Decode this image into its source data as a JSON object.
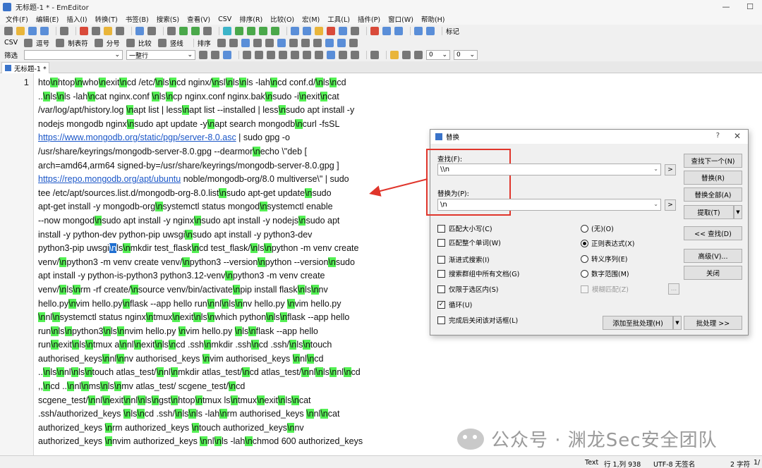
{
  "window": {
    "title": "无标题-1 * - EmEditor"
  },
  "menu": [
    "文件(F)",
    "编辑(E)",
    "插入(I)",
    "转换(T)",
    "书签(B)",
    "搜索(S)",
    "查看(V)",
    "CSV",
    "排序(R)",
    "比较(O)",
    "宏(M)",
    "工具(L)",
    "插件(P)",
    "窗口(W)",
    "帮助(H)"
  ],
  "toolbar1": {
    "label": "标记"
  },
  "toolbar2": {
    "csv": "CSV",
    "items": [
      "逗号",
      "制表符",
      "分号",
      "比较",
      "竖线"
    ],
    "sort": "排序"
  },
  "toolbar3": {
    "filter_label": "筛选",
    "match_label": "一整行",
    "num1": "0",
    "num2": "0"
  },
  "tab": {
    "label": "无标题-1 *"
  },
  "editor": {
    "line_number": "1",
    "lines": [
      [
        [
          "hto",
          0
        ],
        [
          "\\n",
          1
        ],
        [
          "htop",
          0
        ],
        [
          "\\n",
          1
        ],
        [
          "who",
          0
        ],
        [
          "\\n",
          1
        ],
        [
          "exit",
          0
        ],
        [
          "\\n",
          1
        ],
        [
          "cd /etc/",
          0
        ],
        [
          "\\n",
          1
        ],
        [
          "ls",
          0
        ],
        [
          "\\n",
          1
        ],
        [
          "cd nginx/",
          0
        ],
        [
          "\\n",
          1
        ],
        [
          "sl",
          0
        ],
        [
          "\\n",
          1
        ],
        [
          "ls",
          0
        ],
        [
          "\\n",
          1
        ],
        [
          "ls -lah",
          0
        ],
        [
          "\\n",
          1
        ],
        [
          "cd conf.d/",
          0
        ],
        [
          "\\n",
          1
        ],
        [
          "ls",
          0
        ],
        [
          "\\n",
          1
        ],
        [
          "cd",
          0
        ]
      ],
      [
        [
          "..",
          0
        ],
        [
          "\\n",
          1
        ],
        [
          "ls",
          0
        ],
        [
          "\\n",
          1
        ],
        [
          "ls -lah",
          0
        ],
        [
          "\\n",
          1
        ],
        [
          "cat nginx.conf ",
          0
        ],
        [
          "\\n",
          1
        ],
        [
          "ls",
          0
        ],
        [
          "\\n",
          1
        ],
        [
          "cp nginx.conf nginx.bak",
          0
        ],
        [
          "\\n",
          1
        ],
        [
          "sudo -i",
          0
        ],
        [
          "\\n",
          1
        ],
        [
          "exit",
          0
        ],
        [
          "\\n",
          1
        ],
        [
          "cat",
          0
        ]
      ],
      [
        [
          "/var/log/apt/history.log ",
          0
        ],
        [
          "\\n",
          1
        ],
        [
          "apt list | less",
          0
        ],
        [
          "\\n",
          1
        ],
        [
          "apt list --installed | less",
          0
        ],
        [
          "\\n",
          1
        ],
        [
          "sudo apt install -y",
          0
        ]
      ],
      [
        [
          "nodejs mongodb nginx",
          0
        ],
        [
          "\\n",
          1
        ],
        [
          "sudo apt update -y",
          0
        ],
        [
          "\\n",
          1
        ],
        [
          "apt search mongodb",
          0
        ],
        [
          "\\n",
          1
        ],
        [
          "curl -fsSL",
          0
        ]
      ],
      [
        [
          "https://www.mongodb.org/static/pgp/server-8.0.asc",
          2
        ],
        [
          " |    sudo gpg -o",
          0
        ]
      ],
      [
        [
          "/usr/share/keyrings/mongodb-server-8.0.gpg    --dearmor",
          0
        ],
        [
          "\\n",
          1
        ],
        [
          "echo \\\"deb [",
          0
        ]
      ],
      [
        [
          "arch=amd64,arm64 signed-by=/usr/share/keyrings/mongodb-server-8.0.gpg ]",
          0
        ]
      ],
      [
        [
          "https://repo.mongodb.org/apt/ubuntu",
          2
        ],
        [
          " noble/mongodb-org/8.0 multiverse\\\" | sudo",
          0
        ]
      ],
      [
        [
          "tee /etc/apt/sources.list.d/mongodb-org-8.0.list",
          0
        ],
        [
          "\\n",
          1
        ],
        [
          "sudo apt-get update",
          0
        ],
        [
          "\\n",
          1
        ],
        [
          "sudo",
          0
        ]
      ],
      [
        [
          "apt-get install -y mongodb-org",
          0
        ],
        [
          "\\n",
          1
        ],
        [
          "systemctl status mongod",
          0
        ],
        [
          "\\n",
          1
        ],
        [
          "systemctl enable",
          0
        ]
      ],
      [
        [
          "--now mongod",
          0
        ],
        [
          "\\n",
          1
        ],
        [
          "sudo apt install -y nginx",
          0
        ],
        [
          "\\n",
          1
        ],
        [
          "sudo apt install -y nodejs",
          0
        ],
        [
          "\\n",
          1
        ],
        [
          "sudo apt",
          0
        ]
      ],
      [
        [
          "install -y python-dev python-pip uwsgi",
          0
        ],
        [
          "\\n",
          1
        ],
        [
          "sudo apt install -y python3-dev",
          0
        ]
      ],
      [
        [
          "python3-pip uwsgi",
          0
        ],
        [
          "\\n",
          3
        ],
        [
          "ls",
          0
        ],
        [
          "\\n",
          1
        ],
        [
          "mkdir test_flask",
          0
        ],
        [
          "\\n",
          1
        ],
        [
          "cd test_flask/",
          0
        ],
        [
          "\\n",
          1
        ],
        [
          "ls",
          0
        ],
        [
          "\\n",
          1
        ],
        [
          "python -m venv create",
          0
        ]
      ],
      [
        [
          "venv/",
          0
        ],
        [
          "\\n",
          1
        ],
        [
          "python3 -m venv create venv/",
          0
        ],
        [
          "\\n",
          1
        ],
        [
          "python3 --version",
          0
        ],
        [
          "\\n",
          1
        ],
        [
          "python --version",
          0
        ],
        [
          "\\n",
          1
        ],
        [
          "sudo",
          0
        ]
      ],
      [
        [
          "apt install -y python-is-python3 python3.12-venv",
          0
        ],
        [
          "\\n",
          1
        ],
        [
          "python3 -m venv create",
          0
        ]
      ],
      [
        [
          "venv/",
          0
        ],
        [
          "\\n",
          1
        ],
        [
          "ls",
          0
        ],
        [
          "\\n",
          1
        ],
        [
          "rm -rf create/",
          0
        ],
        [
          "\\n",
          1
        ],
        [
          "source venv/bin/activate",
          0
        ],
        [
          "\\n",
          1
        ],
        [
          "pip install flask",
          0
        ],
        [
          "\\n",
          1
        ],
        [
          "ls",
          0
        ],
        [
          "\\n",
          1
        ],
        [
          "nv",
          0
        ]
      ],
      [
        [
          "hello.py",
          0
        ],
        [
          "\\n",
          1
        ],
        [
          "vim hello.py",
          0
        ],
        [
          "\\n",
          1
        ],
        [
          "flask --app hello run",
          0
        ],
        [
          "\\n",
          1
        ],
        [
          "nl",
          0
        ],
        [
          "\\n",
          1
        ],
        [
          "ls",
          0
        ],
        [
          "\\n",
          1
        ],
        [
          "nv hello.py ",
          0
        ],
        [
          "\\n",
          1
        ],
        [
          "vim hello.py",
          0
        ]
      ],
      [
        [
          "\\n",
          1
        ],
        [
          "nl",
          0
        ],
        [
          "\\n",
          1
        ],
        [
          "systemctl status nginx",
          0
        ],
        [
          "\\n",
          1
        ],
        [
          "tmux",
          0
        ],
        [
          "\\n",
          1
        ],
        [
          "exit",
          0
        ],
        [
          "\\n",
          1
        ],
        [
          "ls",
          0
        ],
        [
          "\\n",
          1
        ],
        [
          "which python",
          0
        ],
        [
          "\\n",
          1
        ],
        [
          "ls",
          0
        ],
        [
          "\\n",
          1
        ],
        [
          "flask --app hello",
          0
        ]
      ],
      [
        [
          "run",
          0
        ],
        [
          "\\n",
          1
        ],
        [
          "ls",
          0
        ],
        [
          "\\n",
          1
        ],
        [
          "python3",
          0
        ],
        [
          "\\n",
          1
        ],
        [
          "ls",
          0
        ],
        [
          "\\n",
          1
        ],
        [
          "nvim hello.py ",
          0
        ],
        [
          "\\n",
          1
        ],
        [
          "vim hello.py ",
          0
        ],
        [
          "\\n",
          1
        ],
        [
          "ls",
          0
        ],
        [
          "\\n",
          1
        ],
        [
          "flask --app hello",
          0
        ]
      ],
      [
        [
          "run",
          0
        ],
        [
          "\\n",
          1
        ],
        [
          "exit",
          0
        ],
        [
          "\\n",
          1
        ],
        [
          "ls",
          0
        ],
        [
          "\\n",
          1
        ],
        [
          "tmux a",
          0
        ],
        [
          "\\n",
          1
        ],
        [
          "nl",
          0
        ],
        [
          "\\n",
          1
        ],
        [
          "exit",
          0
        ],
        [
          "\\n",
          1
        ],
        [
          "ls",
          0
        ],
        [
          "\\n",
          1
        ],
        [
          "cd .ssh",
          0
        ],
        [
          "\\n",
          1
        ],
        [
          "mkdir .ssh",
          0
        ],
        [
          "\\n",
          1
        ],
        [
          "cd .ssh/",
          0
        ],
        [
          "\\n",
          1
        ],
        [
          "ls",
          0
        ],
        [
          "\\n",
          1
        ],
        [
          "touch",
          0
        ]
      ],
      [
        [
          "authorised_keys",
          0
        ],
        [
          "\\n",
          1
        ],
        [
          "nl",
          0
        ],
        [
          "\\n",
          1
        ],
        [
          "nv authorised_keys ",
          0
        ],
        [
          "\\n",
          1
        ],
        [
          "vim authorised_keys ",
          0
        ],
        [
          "\\n",
          1
        ],
        [
          "nl",
          0
        ],
        [
          "\\n",
          1
        ],
        [
          "cd",
          0
        ]
      ],
      [
        [
          "..",
          0
        ],
        [
          "\\n",
          1
        ],
        [
          "ls",
          0
        ],
        [
          "\\n",
          1
        ],
        [
          "nl",
          0
        ],
        [
          "\\n",
          1
        ],
        [
          "ls",
          0
        ],
        [
          "\\n",
          1
        ],
        [
          "touch atlas_test/",
          0
        ],
        [
          "\\n",
          1
        ],
        [
          "nl",
          0
        ],
        [
          "\\n",
          1
        ],
        [
          "mkdir atlas_test/",
          0
        ],
        [
          "\\n",
          1
        ],
        [
          "cd atlas_test/",
          0
        ],
        [
          "\\n",
          1
        ],
        [
          "nl",
          0
        ],
        [
          "\\n",
          1
        ],
        [
          "ls",
          0
        ],
        [
          "\\n",
          1
        ],
        [
          "nl",
          0
        ],
        [
          "\\n",
          1
        ],
        [
          "cd",
          0
        ]
      ],
      [
        [
          ",,",
          0
        ],
        [
          "\\n",
          1
        ],
        [
          "cd ..",
          0
        ],
        [
          "\\n",
          1
        ],
        [
          "nl",
          0
        ],
        [
          "\\n",
          1
        ],
        [
          "ms",
          0
        ],
        [
          "\\n",
          1
        ],
        [
          "ls",
          0
        ],
        [
          "\\n",
          1
        ],
        [
          "mv atlas_test/ scgene_test/",
          0
        ],
        [
          "\\n",
          1
        ],
        [
          "cd",
          0
        ]
      ],
      [
        [
          "scgene_test/",
          0
        ],
        [
          "\\n",
          1
        ],
        [
          "nl",
          0
        ],
        [
          "\\n",
          1
        ],
        [
          "exit",
          0
        ],
        [
          "\\n",
          1
        ],
        [
          "nl",
          0
        ],
        [
          "\\n",
          1
        ],
        [
          "ls",
          0
        ],
        [
          "\\n",
          1
        ],
        [
          "gst",
          0
        ],
        [
          "\\n",
          1
        ],
        [
          "htop",
          0
        ],
        [
          "\\n",
          1
        ],
        [
          "tmux ls",
          0
        ],
        [
          "\\n",
          1
        ],
        [
          "tmux",
          0
        ],
        [
          "\\n",
          1
        ],
        [
          "exit",
          0
        ],
        [
          "\\n",
          1
        ],
        [
          "ls",
          0
        ],
        [
          "\\n",
          1
        ],
        [
          "cat",
          0
        ]
      ],
      [
        [
          ".ssh/authorized_keys ",
          0
        ],
        [
          "\\n",
          1
        ],
        [
          "ls",
          0
        ],
        [
          "\\n",
          1
        ],
        [
          "cd .ssh/",
          0
        ],
        [
          "\\n",
          1
        ],
        [
          "ls",
          0
        ],
        [
          "\\n",
          1
        ],
        [
          "ls -lah",
          0
        ],
        [
          "\\n",
          1
        ],
        [
          "rm authorised_keys ",
          0
        ],
        [
          "\\n",
          1
        ],
        [
          "nl",
          0
        ],
        [
          "\\n",
          1
        ],
        [
          "cat",
          0
        ]
      ],
      [
        [
          "authorized_keys ",
          0
        ],
        [
          "\\n",
          1
        ],
        [
          "rm authorized_keys ",
          0
        ],
        [
          "\\n",
          1
        ],
        [
          "touch authorized_keys",
          0
        ],
        [
          "\\n",
          1
        ],
        [
          "nv",
          0
        ]
      ],
      [
        [
          "authorized_keys ",
          0
        ],
        [
          "\\n",
          1
        ],
        [
          "nvim authorized_keys ",
          0
        ],
        [
          "\\n",
          1
        ],
        [
          "nl",
          0
        ],
        [
          "\\n",
          1
        ],
        [
          "ls -lah",
          0
        ],
        [
          "\\n",
          1
        ],
        [
          "chmod 600 authorized_keys",
          0
        ]
      ]
    ]
  },
  "dialog": {
    "title": "替换",
    "help": "?",
    "find_label": "查找(F):",
    "find_value": "\\\\n",
    "replace_label": "替换为(P):",
    "replace_value": "\\n",
    "arrow_btn": ">",
    "buttons": {
      "find_next": "查找下一个(N)",
      "replace": "替换(R)",
      "replace_all": "替换全部(A)",
      "extract": "提取(T)",
      "find_less": "<< 查找(D)",
      "advanced": "高级(V)...",
      "close": "关闭",
      "add_batch": "添加至批处理(H)",
      "batch": "批处理 >>"
    },
    "checkboxes": [
      {
        "label": "匹配大小写(C)",
        "checked": false
      },
      {
        "label": "匹配整个单词(W)",
        "checked": false
      },
      {
        "label": "渐进式搜索(I)",
        "checked": false
      },
      {
        "label": "搜索群组中所有文档(G)",
        "checked": false
      },
      {
        "label": "仅限于选区内(S)",
        "checked": false
      },
      {
        "label": "循环(U)",
        "checked": true
      },
      {
        "label": "完成后关闭该对话框(L)",
        "checked": false
      }
    ],
    "radios": [
      {
        "label": "(无)(O)",
        "on": false
      },
      {
        "label": "正则表达式(X)",
        "on": true
      },
      {
        "label": "转义序列(E)",
        "on": false
      },
      {
        "label": "数字范围(M)",
        "on": false
      }
    ],
    "fuzzy": "模糊匹配(Z)",
    "ellipsis": "..."
  },
  "status": {
    "mode": "Text",
    "position": "行 1,列 938",
    "encoding": "UTF-8 无签名",
    "chars": "2 字符",
    "extra": "1/"
  },
  "watermark": "公众号 · 渊龙Sec安全团队",
  "colors": {
    "highlight": "#54f054",
    "selection": "#1f6fd1",
    "annotation": "#e0352b",
    "link": "#1a56c8"
  }
}
